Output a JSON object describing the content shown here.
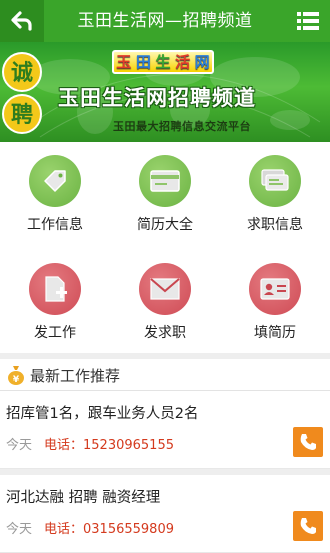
{
  "header": {
    "title": "玉田生活网—招聘频道",
    "back_icon": "back-arrow-icon",
    "menu_icon": "list-menu-icon",
    "color": "#3aa52a"
  },
  "banner": {
    "logo_chars": [
      "玉",
      "田",
      "生",
      "活",
      "网"
    ],
    "badge_chars": [
      "诚",
      "聘"
    ],
    "title": "玉田生活网招聘频道",
    "subtitle": "玉田最大招聘信息交流平台"
  },
  "grid": {
    "items": [
      {
        "label": "工作信息",
        "icon": "tag-icon",
        "color": "#7cbf52"
      },
      {
        "label": "简历大全",
        "icon": "card-icon",
        "color": "#7cbf52"
      },
      {
        "label": "求职信息",
        "icon": "cards-stack-icon",
        "color": "#7cbf52"
      },
      {
        "label": "发工作",
        "icon": "document-add-icon",
        "color": "#d95a62"
      },
      {
        "label": "发求职",
        "icon": "envelope-icon",
        "color": "#d95a62"
      },
      {
        "label": "填简历",
        "icon": "id-card-icon",
        "color": "#d95a62"
      }
    ]
  },
  "section": {
    "title": "最新工作推荐",
    "icon": "money-bag-icon"
  },
  "jobs": [
    {
      "title": "招库管1名，跟车业务人员2名",
      "date": "今天",
      "phone": "电话：15230965155"
    },
    {
      "title": "河北达融 招聘 融资经理",
      "date": "今天",
      "phone": "电话：03156559809"
    }
  ]
}
